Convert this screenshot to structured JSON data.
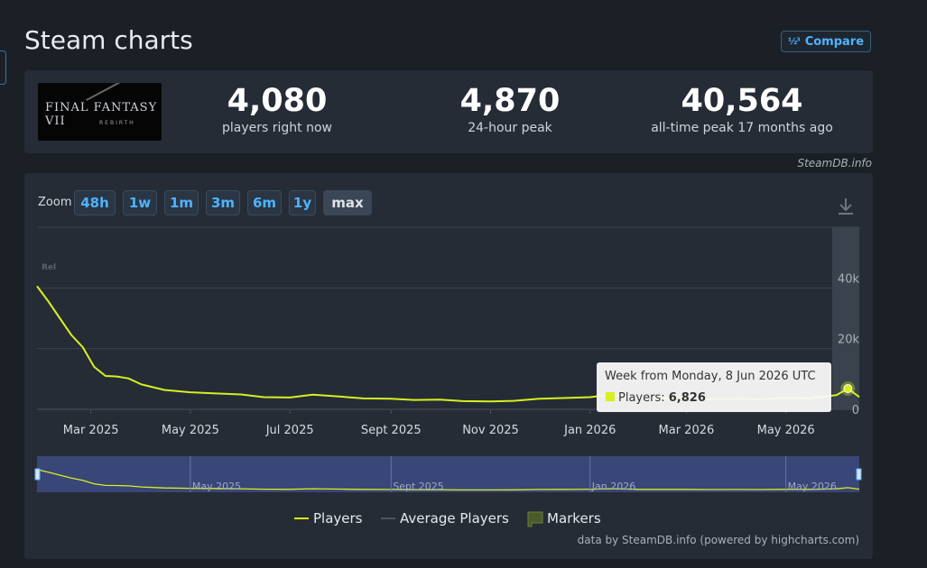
{
  "page": {
    "title": "Steam charts",
    "compare_label": "Compare",
    "compare_icon": "1/2 3",
    "credit": "SteamDB.info",
    "footer_credit": "data by SteamDB.info (powered by highcharts.com)"
  },
  "stats": {
    "game_logo_text": "FINAL FANTASY VII",
    "game_logo_sub": "REBIRTH",
    "players_now": "4,080",
    "players_now_label": "players right now",
    "peak_24h": "4,870",
    "peak_24h_label": "24-hour peak",
    "all_time_peak": "40,564",
    "all_time_peak_label": "all-time peak 17 months ago"
  },
  "zoom": {
    "label": "Zoom",
    "options": [
      "48h",
      "1w",
      "1m",
      "3m",
      "6m",
      "1y",
      "max"
    ],
    "active": "max"
  },
  "tooltip": {
    "title": "Week from Monday, 8 Jun 2026 UTC",
    "series_label": "Players:",
    "value": "6,826"
  },
  "legend": {
    "players": "Players",
    "average": "Average Players",
    "markers": "Markers"
  },
  "colors": {
    "players_line": "#d7f020",
    "background": "#1b2026",
    "panel": "#252c36",
    "accent": "#4fb3ff",
    "navigator": "#3f4e8a"
  },
  "chart_data": {
    "type": "line",
    "x_unit": "date",
    "series": [
      {
        "name": "Players",
        "x": [
          "2025-01-27",
          "2025-02-03",
          "2025-02-10",
          "2025-02-17",
          "2025-02-24",
          "2025-03-03",
          "2025-03-10",
          "2025-03-17",
          "2025-03-24",
          "2025-04-01",
          "2025-04-15",
          "2025-05-01",
          "2025-05-15",
          "2025-06-01",
          "2025-06-15",
          "2025-07-01",
          "2025-07-15",
          "2025-08-01",
          "2025-08-15",
          "2025-09-01",
          "2025-09-15",
          "2025-10-01",
          "2025-10-15",
          "2025-11-01",
          "2025-11-15",
          "2025-12-01",
          "2025-12-15",
          "2026-01-01",
          "2026-01-15",
          "2026-02-01",
          "2026-02-15",
          "2026-03-01",
          "2026-03-15",
          "2026-04-01",
          "2026-04-15",
          "2026-05-01",
          "2026-05-15",
          "2026-06-01",
          "2026-06-08",
          "2026-06-15"
        ],
        "values": [
          40564,
          35500,
          30000,
          24500,
          20500,
          14000,
          11000,
          10800,
          10200,
          8200,
          6400,
          5600,
          5300,
          4900,
          4000,
          3900,
          4800,
          4200,
          3600,
          3500,
          3100,
          3200,
          2700,
          2600,
          2800,
          3500,
          3700,
          4000,
          4900,
          3700,
          3600,
          3600,
          3400,
          3500,
          3300,
          3800,
          3600,
          4700,
          6826,
          4080
        ]
      }
    ],
    "x_tick_labels": [
      "Mar 2025",
      "May 2025",
      "Jul 2025",
      "Sept 2025",
      "Nov 2025",
      "Jan 2026",
      "Mar 2026",
      "May 2026"
    ],
    "x_tick_values": [
      "2025-03-01",
      "2025-05-01",
      "2025-07-01",
      "2025-09-01",
      "2025-11-01",
      "2026-01-01",
      "2026-03-01",
      "2026-05-01"
    ],
    "y_ticks": [
      0,
      20000,
      40000
    ],
    "y_tick_labels": [
      "0",
      "20k",
      "40k"
    ],
    "ylim": [
      0,
      60000
    ],
    "grid": true,
    "legend_position": "bottom-center",
    "navigator_labels": [
      "May 2025",
      "Sept 2025",
      "Jan 2026",
      "May 2026"
    ],
    "navigator_values": [
      "2025-05-01",
      "2025-09-01",
      "2026-01-01",
      "2026-05-01"
    ],
    "corner_label": "Rel"
  }
}
